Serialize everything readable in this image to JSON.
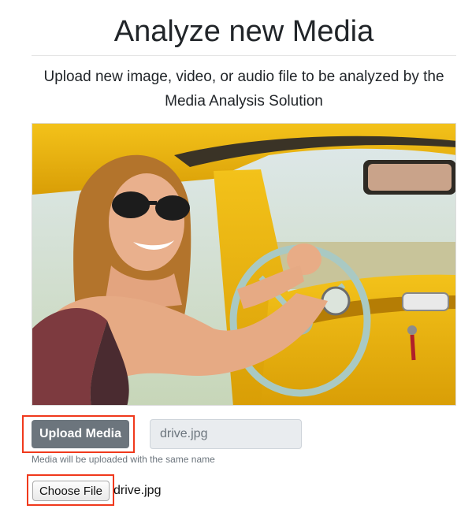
{
  "header": {
    "title": "Analyze new Media",
    "subtitle": "Upload new image, video, or audio file to be analyzed by the Media Analysis Solution"
  },
  "preview": {
    "description": "preview-image",
    "icon": "photo-preview"
  },
  "upload": {
    "button_label": "Upload Media",
    "filename_value": "drive.jpg",
    "help_text": "Media will be uploaded with the same name"
  },
  "file_picker": {
    "button_label": "Choose File",
    "chosen_file": "drive.jpg"
  },
  "colors": {
    "highlight": "#f0391c",
    "button_secondary": "#6c757d",
    "input_disabled_bg": "#e9ecef"
  }
}
